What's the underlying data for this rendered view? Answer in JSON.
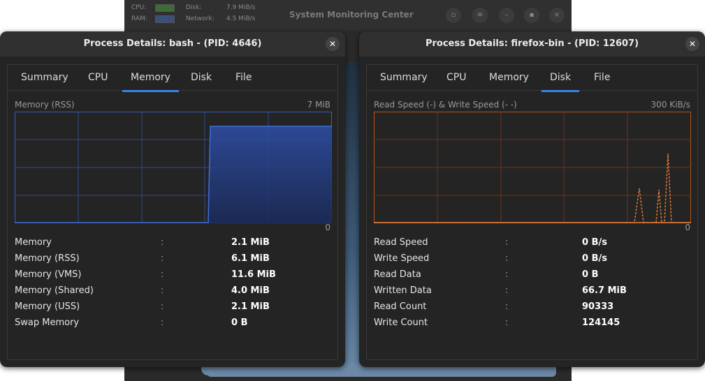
{
  "background_window": {
    "title": "System Monitoring Center",
    "cpu_label": "CPU:",
    "ram_label": "RAM:",
    "disk_label": "Disk:",
    "disk_value": "7.9 MiB/s",
    "network_label": "Network:",
    "network_value": "4.5 MiB/s"
  },
  "left_dialog": {
    "title": "Process Details: bash - (PID: 4646)",
    "tabs": [
      "Summary",
      "CPU",
      "Memory",
      "Disk",
      "File"
    ],
    "active_tab": "Memory",
    "graph": {
      "label": "Memory (RSS)",
      "max": "7 MiB",
      "min": "0",
      "color": "#3d6fd6"
    },
    "rows": [
      {
        "label": "Memory",
        "value": "2.1 MiB"
      },
      {
        "label": "Memory (RSS)",
        "value": "6.1 MiB"
      },
      {
        "label": "Memory (VMS)",
        "value": "11.6 MiB"
      },
      {
        "label": "Memory (Shared)",
        "value": "4.0 MiB"
      },
      {
        "label": "Memory (USS)",
        "value": "2.1 MiB"
      },
      {
        "label": "Swap Memory",
        "value": "0 B"
      }
    ]
  },
  "right_dialog": {
    "title": "Process Details: firefox-bin - (PID: 12607)",
    "tabs": [
      "Summary",
      "CPU",
      "Memory",
      "Disk",
      "File"
    ],
    "active_tab": "Disk",
    "graph": {
      "label": "Read Speed (-) & Write Speed (-  -)",
      "max": "300 KiB/s",
      "min": "0",
      "color": "#e07a3a"
    },
    "rows": [
      {
        "label": "Read Speed",
        "value": "0 B/s"
      },
      {
        "label": "Write Speed",
        "value": "0 B/s"
      },
      {
        "label": "Read Data",
        "value": "0 B"
      },
      {
        "label": "Written Data",
        "value": "66.7 MiB"
      },
      {
        "label": "Read Count",
        "value": "90333"
      },
      {
        "label": "Write Count",
        "value": "124145"
      }
    ]
  },
  "separator": ":"
}
